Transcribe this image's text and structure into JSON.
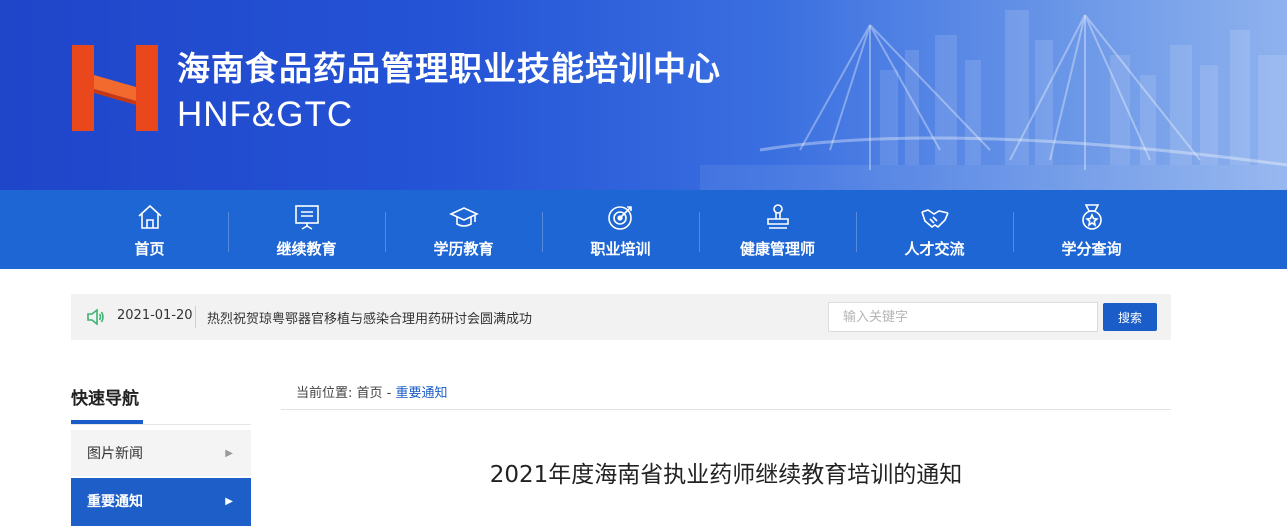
{
  "header": {
    "title": "海南食品药品管理职业技能培训中心",
    "subtitle": "HNF&GTC",
    "logo_icon": "hnfgtc-logo-icon",
    "logo_color": "#e8481b"
  },
  "nav": {
    "items": [
      {
        "label": "首页",
        "icon": "home-icon"
      },
      {
        "label": "继续教育",
        "icon": "presentation-board-icon"
      },
      {
        "label": "学历教育",
        "icon": "graduation-cap-icon"
      },
      {
        "label": "职业培训",
        "icon": "target-icon"
      },
      {
        "label": "健康管理师",
        "icon": "stamp-icon"
      },
      {
        "label": "人才交流",
        "icon": "handshake-icon"
      },
      {
        "label": "学分查询",
        "icon": "medal-icon"
      }
    ],
    "background": "#1d66d3"
  },
  "notice": {
    "icon": "speaker-icon",
    "date": "2021-01-20",
    "text": "热烈祝贺琼粤鄂器官移植与感染合理用药研讨会圆满成功"
  },
  "search": {
    "placeholder": "输入关键字",
    "value": "",
    "button_label": "搜索"
  },
  "sidebar": {
    "title": "快速导航",
    "items": [
      {
        "label": "图片新闻"
      },
      {
        "label": "重要通知"
      }
    ]
  },
  "breadcrumb": {
    "prefix": "当前位置:",
    "home": "首页",
    "separator": " - ",
    "current": "重要通知"
  },
  "article": {
    "title": "2021年度海南省执业药师继续教育培训的通知"
  },
  "colors": {
    "accent": "#1a5cc8",
    "banner": "#2554d6"
  }
}
